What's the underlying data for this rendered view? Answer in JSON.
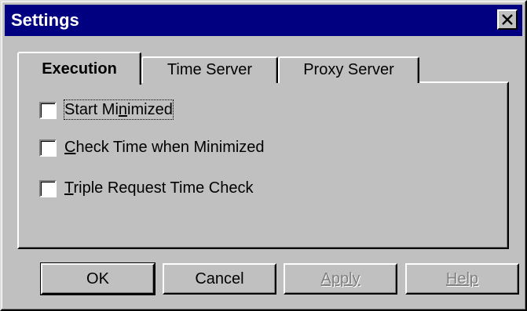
{
  "window": {
    "title": "Settings"
  },
  "tabs": [
    {
      "label": "Execution",
      "active": true
    },
    {
      "label": "Time Server",
      "active": false
    },
    {
      "label": "Proxy Server",
      "active": false
    }
  ],
  "checkboxes": [
    {
      "pre": "Start Mi",
      "u": "n",
      "post": "imized",
      "checked": false
    },
    {
      "pre": "",
      "u": "C",
      "post": "heck Time when Minimized",
      "checked": false
    },
    {
      "pre": "",
      "u": "T",
      "post": "riple Request Time Check",
      "checked": false
    }
  ],
  "buttons": {
    "ok": "OK",
    "cancel": "Cancel",
    "apply": "Apply",
    "help": "Help"
  },
  "colors": {
    "title_bar": "#000080",
    "face": "#c0c0c0",
    "disabled_text": "#808080"
  },
  "icons": {
    "close": "close-icon"
  }
}
